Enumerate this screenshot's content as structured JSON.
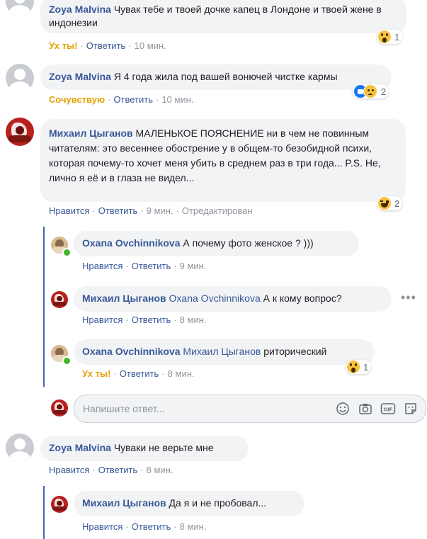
{
  "comments": [
    {
      "author": "Zoya Malvina",
      "text": "Чувак тебе и твоей дочке капец в Лондоне и твоей жене в индонезии",
      "actions": {
        "reaction": "Ух ты!",
        "reply": "Ответить",
        "time": "10 мин."
      },
      "reaction_badge": {
        "icons": [
          "wow"
        ],
        "count": "1"
      }
    },
    {
      "author": "Zoya Malvina",
      "text": "Я 4 года жила под вашей вонючей чистке кармы",
      "actions": {
        "reaction": "Сочувствую",
        "reply": "Ответить",
        "time": "10 мин."
      },
      "reaction_badge": {
        "icons": [
          "like",
          "sad"
        ],
        "count": "2"
      }
    },
    {
      "author": "Михаил Цыганов",
      "text": "МАЛЕНЬКОЕ ПОЯСНЕНИЕ ни в чем не повинным читателям: это весеннее обострение у в общем-то безобидной психи, которая почему-то хочет меня убить в среднем раз в три года... P.S. Не, лично я её и в глаза не видел...",
      "actions": {
        "like": "Нравится",
        "reply": "Ответить",
        "time": "9 мин.",
        "edited": "Отредактирован"
      },
      "reaction_badge": {
        "icons": [
          "haha"
        ],
        "count": "2"
      },
      "replies": [
        {
          "author": "Oxana Ovchinnikova",
          "text": "А почему фото женское ? )))",
          "actions": {
            "like": "Нравится",
            "reply": "Ответить",
            "time": "9 мин."
          }
        },
        {
          "author": "Михаил Цыганов",
          "mention": "Oxana Ovchinnikova",
          "text": "А к кому вопрос?",
          "actions": {
            "like": "Нравится",
            "reply": "Ответить",
            "time": "8 мин."
          }
        },
        {
          "author": "Oxana Ovchinnikova",
          "mention": "Михаил Цыганов",
          "text": "риторический",
          "actions": {
            "reaction": "Ух ты!",
            "reply": "Ответить",
            "time": "8 мин."
          },
          "reaction_badge": {
            "icons": [
              "wow"
            ],
            "count": "1"
          }
        }
      ],
      "reply_box": {
        "placeholder": "Напишите ответ...",
        "icons": [
          "emoji-icon",
          "camera-icon",
          "gif-icon",
          "sticker-icon"
        ],
        "gif_label": "GIF"
      }
    },
    {
      "author": "Zoya Malvina",
      "text": "Чуваки не верьте мне",
      "actions": {
        "like": "Нравится",
        "reply": "Ответить",
        "time": "8 мин."
      },
      "replies": [
        {
          "author": "Михаил Цыганов",
          "text": "Да я и не пробовал...",
          "actions": {
            "like": "Нравится",
            "reply": "Ответить",
            "time": "8 мин."
          }
        }
      ]
    }
  ],
  "colors": {
    "name": "#385898",
    "bubble": "#f2f3f5",
    "reaction_text": "#e4a100",
    "thread_line": "#4267b2"
  }
}
